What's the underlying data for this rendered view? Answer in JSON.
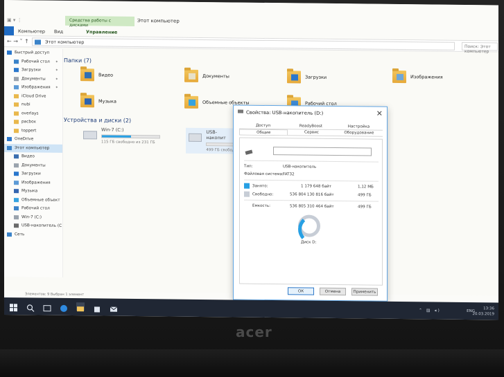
{
  "window": {
    "context_tab": "Средства работы с дисками",
    "title": "Этот компьютер",
    "ribbon_tabs": [
      "Компьютер",
      "Вид",
      "Управление"
    ]
  },
  "address": {
    "path": "Этот компьютер",
    "search_placeholder": "Поиск: Этот компьютер"
  },
  "sidebar": {
    "items": [
      {
        "label": "Быстрый доступ",
        "icon": "star-icon",
        "pinned": false,
        "level": 0
      },
      {
        "label": "Рабочий стол",
        "icon": "desktop-icon",
        "pinned": true,
        "level": 1
      },
      {
        "label": "Загрузки",
        "icon": "download-icon",
        "pinned": true,
        "level": 1
      },
      {
        "label": "Документы",
        "icon": "document-icon",
        "pinned": true,
        "level": 1
      },
      {
        "label": "Изображения",
        "icon": "image-icon",
        "pinned": true,
        "level": 1
      },
      {
        "label": "iCloud Drive",
        "icon": "folder-icon",
        "pinned": false,
        "level": 1
      },
      {
        "label": "nubi",
        "icon": "folder-icon",
        "pinned": false,
        "level": 1
      },
      {
        "label": "overlays",
        "icon": "folder-icon",
        "pinned": false,
        "level": 1
      },
      {
        "label": "pacbox",
        "icon": "folder-icon",
        "pinned": false,
        "level": 1
      },
      {
        "label": "toppert",
        "icon": "folder-icon",
        "pinned": false,
        "level": 1
      },
      {
        "label": "OneDrive",
        "icon": "cloud-icon",
        "pinned": false,
        "level": 0
      },
      {
        "label": "Этот компьютер",
        "icon": "computer-icon",
        "pinned": false,
        "level": 0,
        "selected": true
      },
      {
        "label": "Видео",
        "icon": "video-icon",
        "pinned": false,
        "level": 1
      },
      {
        "label": "Документы",
        "icon": "document-icon",
        "pinned": false,
        "level": 1
      },
      {
        "label": "Загрузки",
        "icon": "download-icon",
        "pinned": false,
        "level": 1
      },
      {
        "label": "Изображения",
        "icon": "image-icon",
        "pinned": false,
        "level": 1
      },
      {
        "label": "Музыка",
        "icon": "music-icon",
        "pinned": false,
        "level": 1
      },
      {
        "label": "Объемные объект",
        "icon": "cube-icon",
        "pinned": false,
        "level": 1
      },
      {
        "label": "Рабочий стол",
        "icon": "desktop-icon",
        "pinned": false,
        "level": 1
      },
      {
        "label": "Win-7 (C:)",
        "icon": "drive-icon",
        "pinned": false,
        "level": 1
      },
      {
        "label": "USB-накопитель (С",
        "icon": "usb-drive-icon",
        "pinned": false,
        "level": 1
      },
      {
        "label": "Сеть",
        "icon": "network-icon",
        "pinned": false,
        "level": 0
      }
    ]
  },
  "content": {
    "folders_header": "Папки (7)",
    "folders": [
      {
        "label": "Видео",
        "icon": "video-folder-icon"
      },
      {
        "label": "Документы",
        "icon": "documents-folder-icon"
      },
      {
        "label": "Загрузки",
        "icon": "downloads-folder-icon"
      },
      {
        "label": "Изображения",
        "icon": "pictures-folder-icon"
      },
      {
        "label": "Музыка",
        "icon": "music-folder-icon"
      },
      {
        "label": "Объемные объекты",
        "icon": "3d-objects-folder-icon"
      },
      {
        "label": "Рабочий стол",
        "icon": "desktop-folder-icon"
      }
    ],
    "drives_header": "Устройства и диски (2)",
    "drives": [
      {
        "label": "Win-7 (C:)",
        "free": "115 ГБ свободно из 231 ГБ",
        "used_fraction": 0.5
      },
      {
        "label": "USB-накопит",
        "free": "499 ГБ свобод",
        "used_fraction": 0.0
      }
    ]
  },
  "statusbar": "Элементов: 9    Выбран 1 элемент",
  "dialog": {
    "title": "Свойства: USB-накопитель (D:)",
    "tabs_row1": [
      "Доступ",
      "ReadyBoost",
      "Настройка"
    ],
    "tabs_row2": [
      "Общие",
      "Сервис",
      "Оборудование"
    ],
    "active_tab": "Общие",
    "type_label": "Тип:",
    "type_value": "USB-накопитель",
    "fs_label": "Файловая система:",
    "fs_value": "FAT32",
    "used_label": "Занято:",
    "used_bytes": "1 179 648 байт",
    "used_size": "1,12 МБ",
    "free_label": "Свободно:",
    "free_bytes": "536 804 130 816 байт",
    "free_size": "499 ГБ",
    "capacity_label": "Емкость:",
    "capacity_bytes": "536 805 310 464 байт",
    "capacity_size": "499 ГБ",
    "disk_label": "Диск D:",
    "used_fraction": 0.0,
    "btn_ok": "ОК",
    "btn_cancel": "Отмена",
    "btn_apply": "Применить",
    "colors": {
      "used": "#27a0e4",
      "free": "#c7cdd6"
    }
  },
  "taskbar": {
    "time": "13:36",
    "date": "20.03.2019",
    "lang": "ENG"
  },
  "brand": "acer"
}
